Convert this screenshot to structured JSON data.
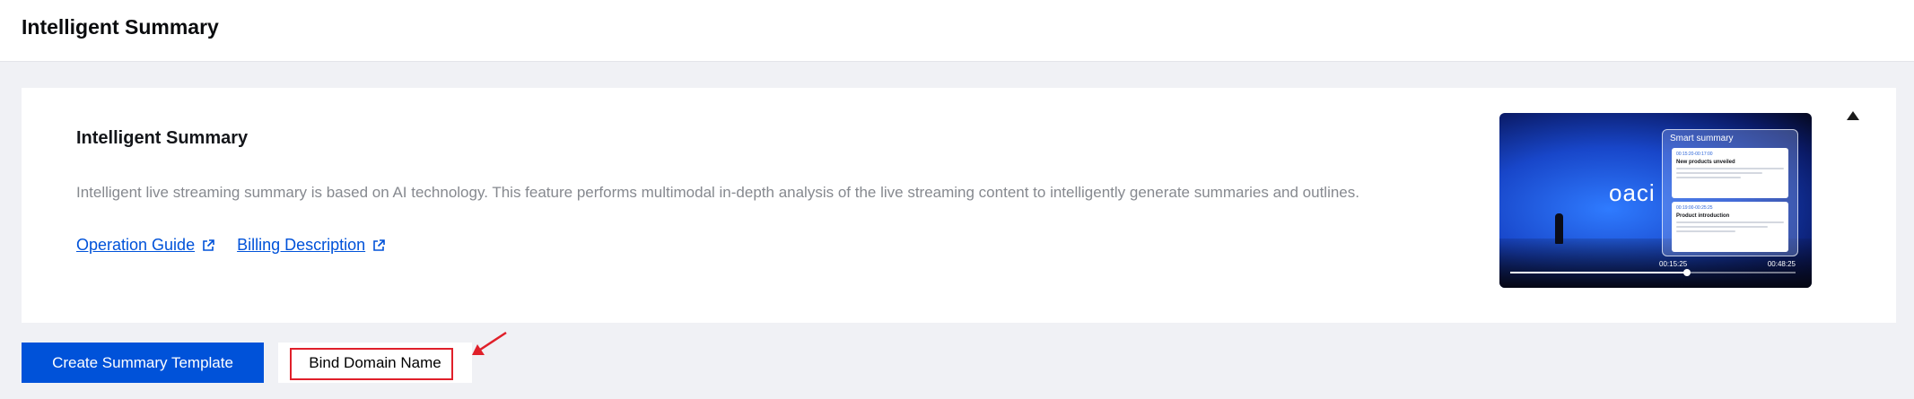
{
  "header": {
    "title": "Intelligent Summary"
  },
  "card": {
    "title": "Intelligent Summary",
    "description": "Intelligent live streaming summary is based on AI technology. This feature performs multimodal in-depth analysis of the live streaming content to intelligently generate summaries and outlines.",
    "links": [
      {
        "label": "Operation Guide"
      },
      {
        "label": "Billing Description"
      }
    ]
  },
  "preview": {
    "brand": "oaci",
    "panel_title": "Smart summary",
    "items": [
      {
        "time": "00:15:20-00:17:00",
        "heading": "New products unveiled"
      },
      {
        "time": "00:19:00-00:25:25",
        "heading": "Product introduction"
      }
    ],
    "current_time": "00:15:25",
    "total_time": "00:48:25",
    "progress": 0.62
  },
  "actions": {
    "create_label": "Create Summary Template",
    "bind_label": "Bind Domain Name"
  },
  "colors": {
    "primary": "#0052d9",
    "highlight": "#e0202a"
  }
}
